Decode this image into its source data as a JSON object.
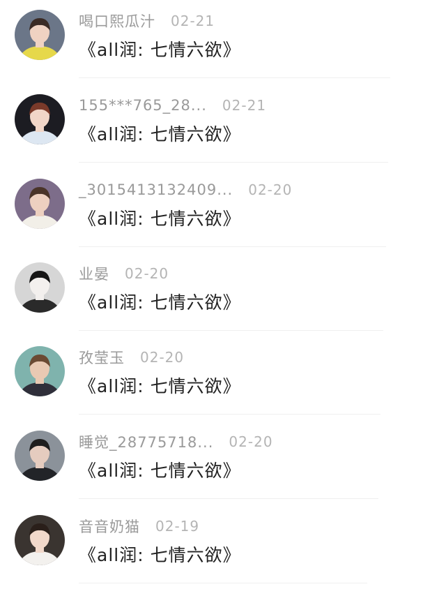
{
  "comments": [
    {
      "name": "喝口熙瓜汁",
      "date": "02-21",
      "title": "《all润: 七情六欲》",
      "avatar": {
        "bg": "#6b7688",
        "skin": "#efd2c2",
        "hair": "#3a2b25",
        "shirt": "#e6d84a"
      }
    },
    {
      "name": "155***765_28...",
      "date": "02-21",
      "title": "《all润: 七情六欲》",
      "avatar": {
        "bg": "#1c1c22",
        "skin": "#f1d6c8",
        "hair": "#7a3a2a",
        "shirt": "#dde7f2"
      }
    },
    {
      "name": "_3015413132409...",
      "date": "02-20",
      "title": "《all润: 七情六欲》",
      "avatar": {
        "bg": "#7d6d8a",
        "skin": "#edd0c0",
        "hair": "#4a3429",
        "shirt": "#f2efe8"
      }
    },
    {
      "name": "业晏",
      "date": "02-20",
      "title": "《all润: 七情六欲》",
      "avatar": {
        "bg": "#d6d6d6",
        "skin": "#f3f0ee",
        "hair": "#151515",
        "shirt": "#2a2a2a"
      }
    },
    {
      "name": "孜莹玉",
      "date": "02-20",
      "title": "《all润: 七情六欲》",
      "avatar": {
        "bg": "#7fb3ad",
        "skin": "#e9c9b3",
        "hair": "#6b4a33",
        "shirt": "#2f2f3a"
      }
    },
    {
      "name": "睡觉_28775718...",
      "date": "02-20",
      "title": "《all润: 七情六欲》",
      "avatar": {
        "bg": "#8b929a",
        "skin": "#e5ccbf",
        "hair": "#1d1d1d",
        "shirt": "#222428"
      }
    },
    {
      "name": "音音奶猫",
      "date": "02-19",
      "title": "《all润: 七情六欲》",
      "avatar": {
        "bg": "#3a3430",
        "skin": "#f1d8ca",
        "hair": "#2a1f1a",
        "shirt": "#f3f1ee"
      }
    }
  ]
}
